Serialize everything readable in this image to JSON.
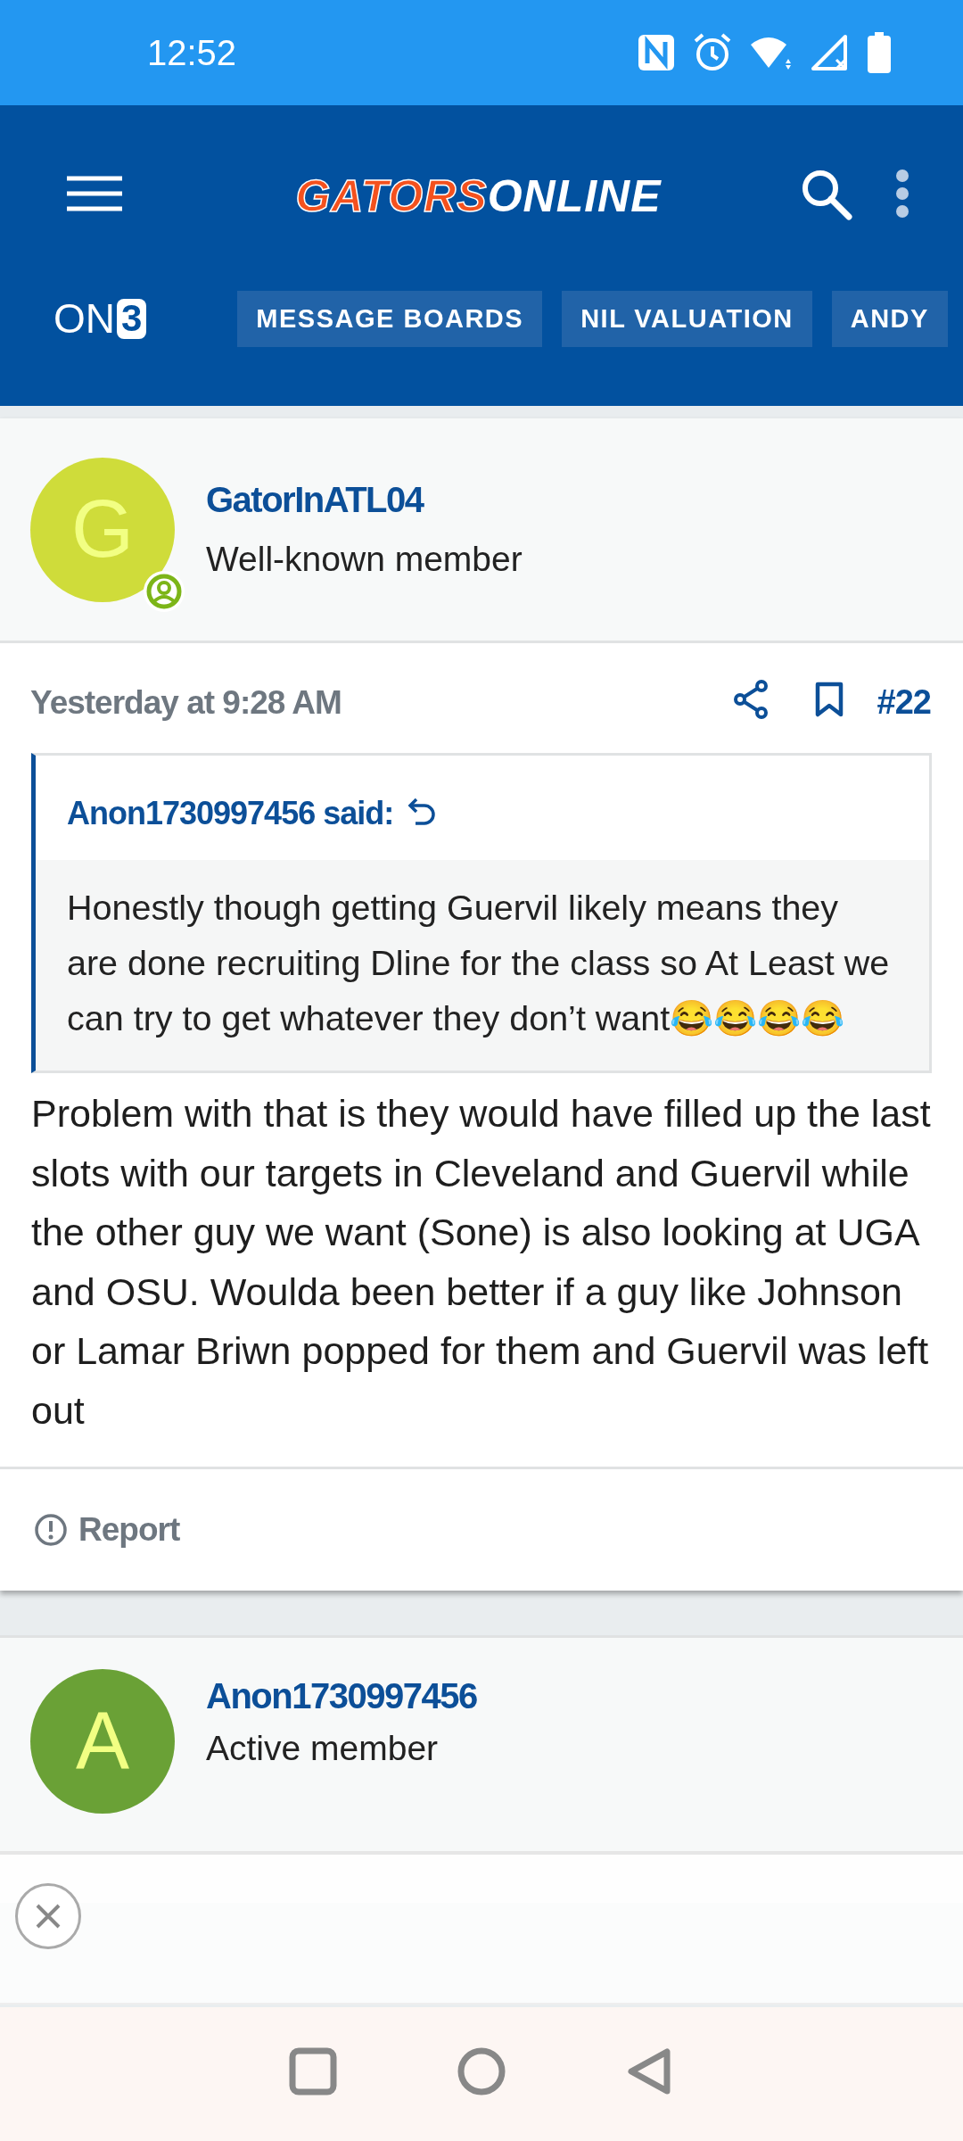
{
  "status_bar": {
    "time": "12:52"
  },
  "header": {
    "logo": {
      "primary": "GATORS",
      "secondary": "ONLINE"
    },
    "network_logo": {
      "prefix": "ON",
      "suffix": "3"
    },
    "nav_links": [
      {
        "label": "MESSAGE BOARDS"
      },
      {
        "label": "NIL VALUATION"
      },
      {
        "label": "ANDY"
      }
    ]
  },
  "post": {
    "author": {
      "initial": "G",
      "color": "#cfdc3a",
      "name": "GatorInATL04",
      "role": "Well-known member"
    },
    "timestamp": "Yesterday at 9:28 AM",
    "number": "#22",
    "quote": {
      "author": "Anon1730997456 said:",
      "text": "Honestly though getting Guervil likely means they are done recruiting Dline for the class so At Least we can try to get whatever they don’t want😂😂😂😂"
    },
    "body": "Problem with that is they would have filled up the last slots with our targets in Cleveland and Guervil while the other guy we want (Sone) is also looking at UGA and OSU. Woulda been better if a guy like Johnson or Lamar Briwn popped for them and Guervil was left out",
    "report": "Report"
  },
  "next_post": {
    "author": {
      "initial": "A",
      "color": "#6aa136",
      "name": "Anon1730997456",
      "role": "Active member"
    }
  }
}
